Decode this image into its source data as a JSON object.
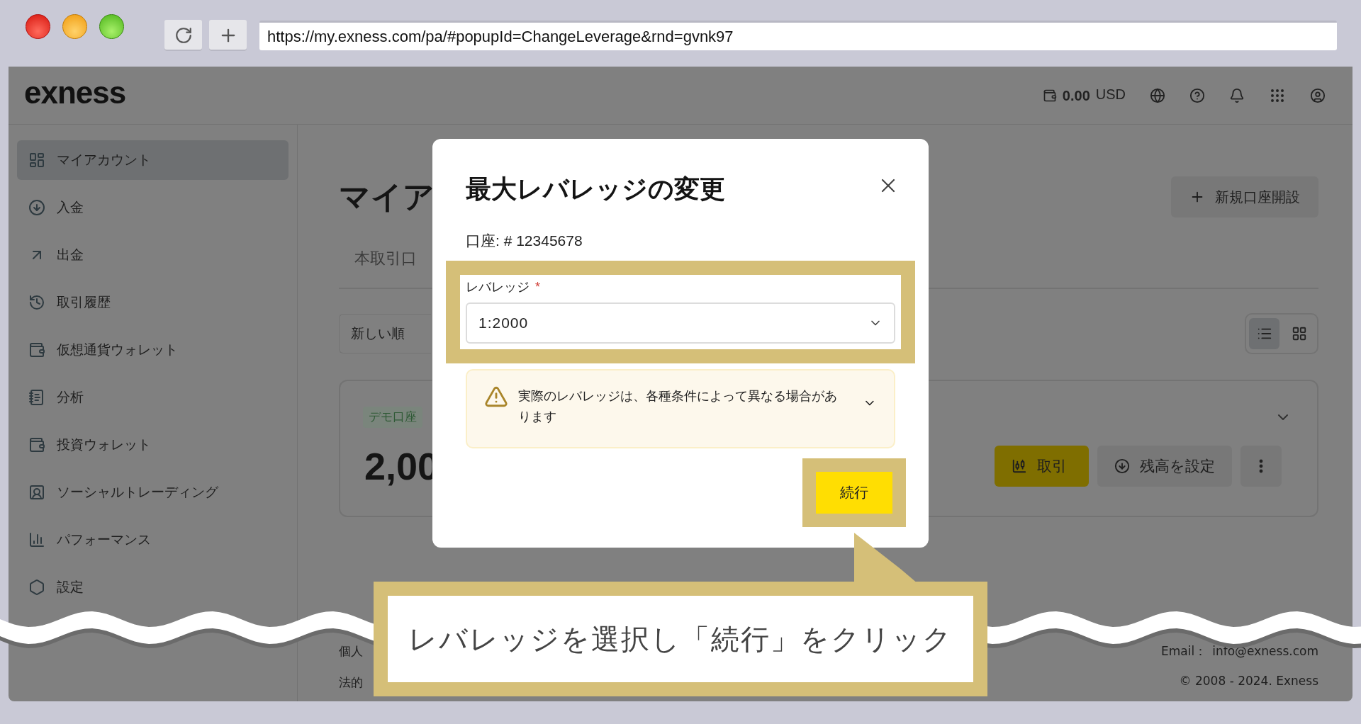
{
  "browser": {
    "url": "https://my.exness.com/pa/#popupId=ChangeLeverage&rnd=gvnk97"
  },
  "header": {
    "logo": "exness",
    "balance": "0.00",
    "currency": "USD"
  },
  "sidebar": {
    "items": [
      {
        "label": "マイアカウント",
        "selected": true
      },
      {
        "label": "入金",
        "selected": false
      },
      {
        "label": "出金",
        "selected": false
      },
      {
        "label": "取引履歴",
        "selected": false
      },
      {
        "label": "仮想通貨ウォレット",
        "selected": false
      },
      {
        "label": "分析",
        "selected": false
      },
      {
        "label": "投資ウォレット",
        "selected": false
      },
      {
        "label": "ソーシャルトレーディング",
        "selected": false
      },
      {
        "label": "パフォーマンス",
        "selected": false
      },
      {
        "label": "設定",
        "selected": false
      }
    ]
  },
  "main": {
    "title": "マイア",
    "new_account_button": "新規口座開設",
    "tab": "本取引口",
    "sort": "新しい順",
    "view_toggle": [
      {
        "selected": true
      },
      {
        "selected": false
      }
    ],
    "card": {
      "badge": "デモ口座",
      "balance": "2,00",
      "actions": [
        "取引",
        "残高を設定"
      ]
    }
  },
  "footer": {
    "left": [
      "個人",
      "法的"
    ],
    "email_label": "Email：",
    "email": "info@exness.com",
    "copyright": "© 2008 - 2024. Exness"
  },
  "modal": {
    "title": "最大レバレッジの変更",
    "account": "口座: # 12345678",
    "field_label": "レバレッジ",
    "required_mark": "*",
    "value": "1:2000",
    "warning": "実際のレバレッジは、各種条件によって異なる場合があります",
    "button": "続行"
  },
  "callout": {
    "text": "レバレッジを選択し「続行」をクリック"
  }
}
